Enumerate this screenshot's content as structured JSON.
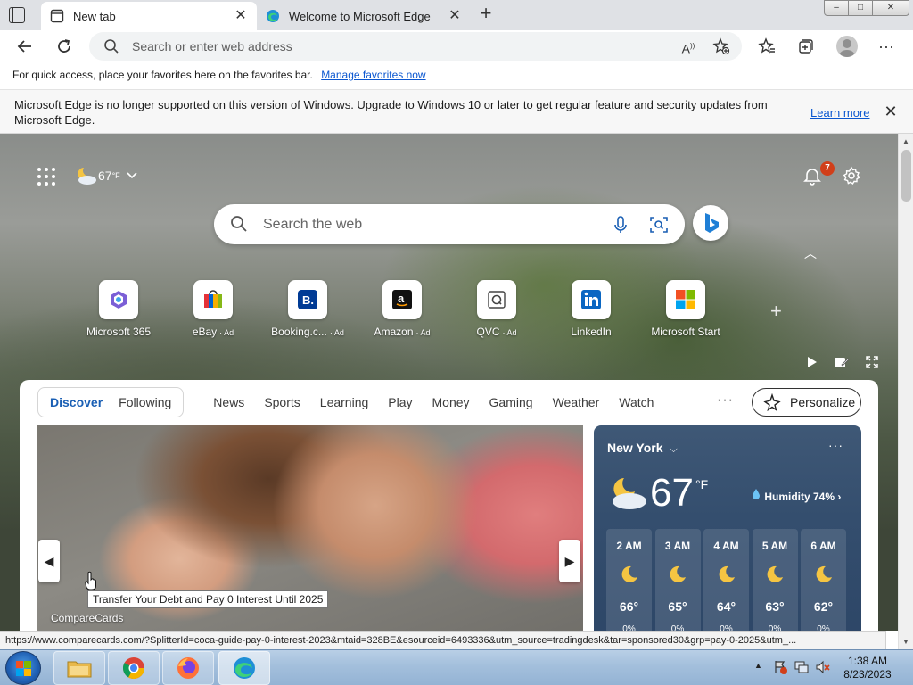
{
  "tabs": [
    {
      "title": "New tab",
      "favicon": "new-tab-icon",
      "active": true
    },
    {
      "title": "Welcome to Microsoft Edge",
      "favicon": "edge-icon",
      "active": false
    }
  ],
  "toolbar": {
    "address_placeholder": "Search or enter web address"
  },
  "favorites_bar": {
    "message": "For quick access, place your favorites here on the favorites bar.",
    "link": "Manage favorites now"
  },
  "notice": {
    "message": "Microsoft Edge is no longer supported on this version of Windows. Upgrade to Windows 10 or later to get regular feature and security updates from Microsoft Edge.",
    "link": "Learn more"
  },
  "ntp": {
    "weather_temp": "67",
    "weather_unit": "°F",
    "notification_count": "7",
    "search_placeholder": "Search the web",
    "quick_links": [
      {
        "label": "Microsoft 365",
        "ad": ""
      },
      {
        "label": "eBay",
        "ad": "· Ad"
      },
      {
        "label": "Booking.c...",
        "ad": "· Ad"
      },
      {
        "label": "Amazon",
        "ad": "· Ad"
      },
      {
        "label": "QVC",
        "ad": "· Ad"
      },
      {
        "label": "LinkedIn",
        "ad": ""
      },
      {
        "label": "Microsoft Start",
        "ad": ""
      }
    ]
  },
  "feed": {
    "pill_tabs": [
      "Discover",
      "Following"
    ],
    "tabs": [
      "News",
      "Sports",
      "Learning",
      "Play",
      "Money",
      "Gaming",
      "Weather",
      "Watch"
    ],
    "personalize": "Personalize",
    "hero_source": "CompareCards",
    "tooltip": "Transfer Your Debt and Pay 0 Interest Until 2025"
  },
  "weather": {
    "city": "New York",
    "temp": "67",
    "unit": "°F",
    "humidity": "Humidity 74%",
    "hourly": [
      {
        "time": "2 AM",
        "temp": "66°",
        "precip": "0%"
      },
      {
        "time": "3 AM",
        "temp": "65°",
        "precip": "0%"
      },
      {
        "time": "4 AM",
        "temp": "64°",
        "precip": "0%"
      },
      {
        "time": "5 AM",
        "temp": "63°",
        "precip": "0%"
      },
      {
        "time": "6 AM",
        "temp": "62°",
        "precip": "0%"
      }
    ]
  },
  "status_url": "https://www.comparecards.com/?SplitterId=coca-guide-pay-0-interest-2023&mtaid=328BE&esourceid=6493336&utm_source=tradingdesk&tar=sponsored30&grp=pay-0-2025&utm_...",
  "taskbar": {
    "time": "1:38 AM",
    "date": "8/23/2023"
  }
}
